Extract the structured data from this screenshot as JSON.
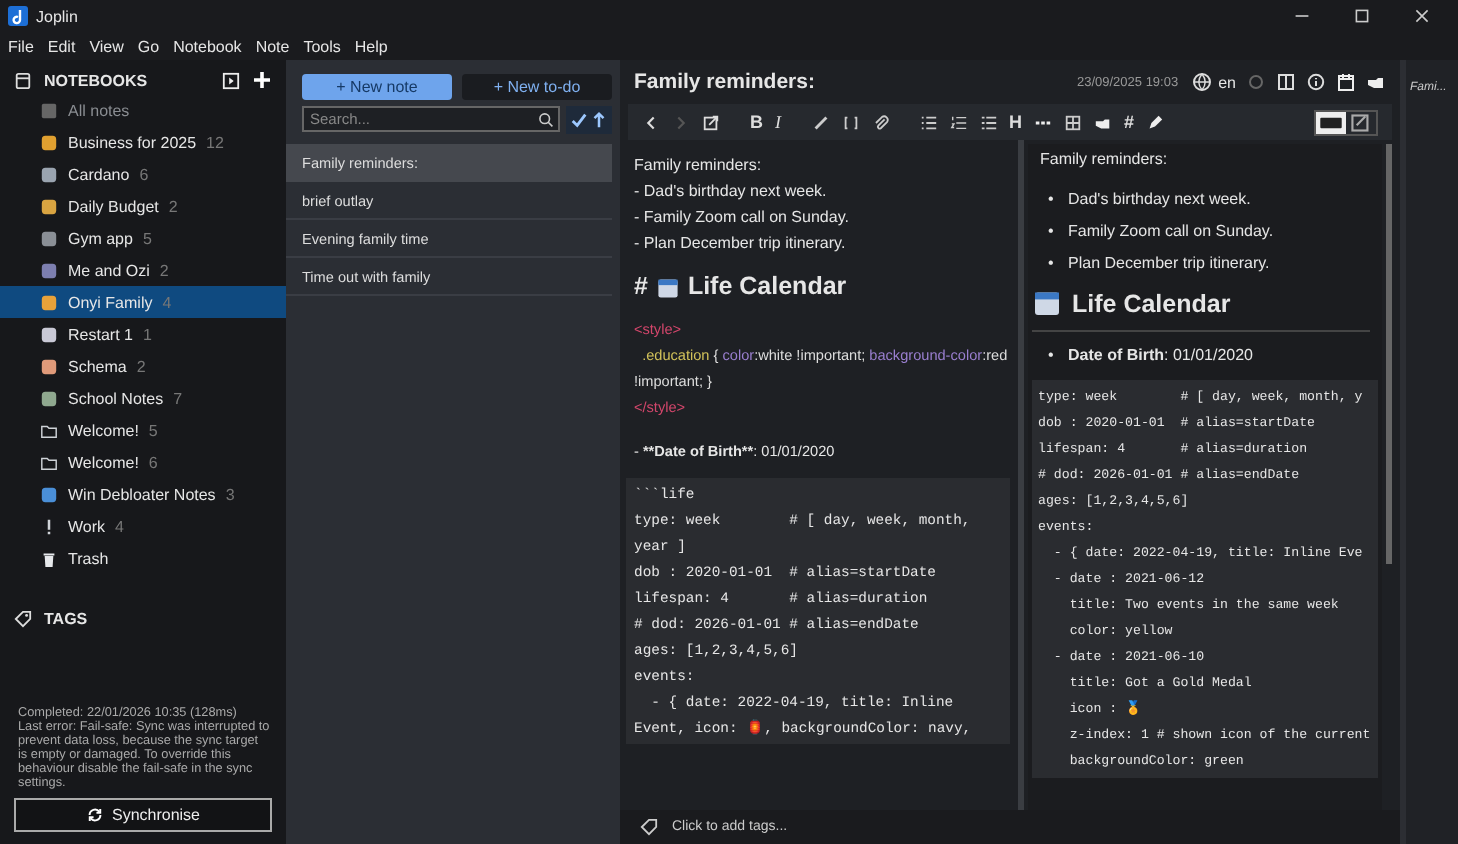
{
  "window": {
    "title": "Joplin"
  },
  "menu": [
    "File",
    "Edit",
    "View",
    "Go",
    "Notebook",
    "Note",
    "Tools",
    "Help"
  ],
  "sidebar": {
    "heading": "NOTEBOOKS",
    "all_notes": "All notes",
    "notebooks": [
      {
        "name": "Business for 2025",
        "count": "12",
        "kind": "emoji",
        "color": "#e0a030",
        "selected": false
      },
      {
        "name": "Cardano",
        "count": "6",
        "kind": "emoji",
        "color": "#9aa4b0",
        "selected": false
      },
      {
        "name": "Daily Budget",
        "count": "2",
        "kind": "emoji",
        "color": "#d9a441",
        "selected": false
      },
      {
        "name": "Gym app",
        "count": "5",
        "kind": "emoji",
        "color": "#8a8f96",
        "selected": false
      },
      {
        "name": "Me and Ozi",
        "count": "2",
        "kind": "emoji",
        "color": "#7d7fb0",
        "selected": false
      },
      {
        "name": "Onyi Family",
        "count": "4",
        "kind": "emoji",
        "color": "#e8a23a",
        "selected": true
      },
      {
        "name": "Restart 1",
        "count": "1",
        "kind": "emoji",
        "color": "#c9c9d6",
        "selected": false
      },
      {
        "name": "Schema",
        "count": "2",
        "kind": "emoji",
        "color": "#e09a7a",
        "selected": false
      },
      {
        "name": "School Notes",
        "count": "7",
        "kind": "emoji",
        "color": "#8fa88f",
        "selected": false
      },
      {
        "name": "Welcome!",
        "count": "5",
        "kind": "folder",
        "color": "#cfd3d8",
        "selected": false
      },
      {
        "name": "Welcome!",
        "count": "6",
        "kind": "folder",
        "color": "#cfd3d8",
        "selected": false
      },
      {
        "name": "Win Debloater Notes",
        "count": "3",
        "kind": "emoji",
        "color": "#4a8fd8",
        "selected": false
      },
      {
        "name": "Work",
        "count": "4",
        "kind": "bang",
        "color": "#cfd3d8",
        "selected": false
      },
      {
        "name": "Trash",
        "kind": "trash",
        "color": "#e6e8eb",
        "selected": false
      }
    ],
    "tags_heading": "TAGS",
    "sync_status": "Completed: 22/01/2026 10:35 (128ms)\nLast error: Fail-safe: Sync was interrupted to prevent data loss, because the sync target is empty or damaged. To override this behaviour disable the fail-safe in the sync settings.",
    "sync_button": "Synchronise"
  },
  "note_list": {
    "new_note": "New note",
    "new_todo": "New to-do",
    "plus": "+",
    "search": {
      "placeholder": "Search..."
    },
    "notes": [
      {
        "title": "Family reminders:",
        "selected": true
      },
      {
        "title": "brief outlay",
        "selected": false
      },
      {
        "title": "Evening family time",
        "selected": false
      },
      {
        "title": "Time out with family",
        "selected": false
      }
    ]
  },
  "editor": {
    "title": "Family reminders:",
    "date": "23/09/2025 19:03",
    "language": "en",
    "toolbar_glyphs": [
      "B",
      "I",
      "H",
      "#"
    ],
    "source": {
      "lines": [
        "Family reminders:",
        "- Dad's birthday next week.",
        "- Family Zoom call on Sunday.",
        "- Plan December trip itinerary."
      ],
      "heading_mark": "#",
      "heading": "Life Calendar",
      "style_open": "<style>",
      "css_selector": ".education",
      "css_brace": " { ",
      "css_body_1": "color",
      "css_body_2": ":white !important; ",
      "css_body_3": "background-color",
      "css_body_4": ":red !important; }",
      "style_close": "</style>",
      "dob_prefix": "- ",
      "dob_bold": "**Date of Birth**",
      "dob_value": ": 01/01/2020",
      "code": "```life\ntype: week        # [ day, week, month, year ]\ndob : 2020-01-01  # alias=startDate\nlifespan: 4       # alias=duration\n# dod: 2026-01-01 # alias=endDate\nages: [1,2,3,4,5,6]\nevents:\n  - { date: 2022-04-19, title: Inline Event, icon: 🏮, backgroundColor: navy,"
    },
    "preview": {
      "marker": "•",
      "intro": "Family reminders:",
      "bullets": [
        "Dad's birthday next week.",
        "Family Zoom call on Sunday.",
        "Plan December trip itinerary."
      ],
      "heading": "Life Calendar",
      "dob_label": "Date of Birth",
      "dob_value": ": 01/01/2020",
      "code": [
        "type: week        # [ day, week, month, y",
        "dob : 2020-01-01  # alias=startDate",
        "lifespan: 4       # alias=duration",
        "# dod: 2026-01-01 # alias=endDate",
        "ages: [1,2,3,4,5,6]",
        "events:",
        "  - { date: 2022-04-19, title: Inline Eve",
        "  - date : 2021-06-12",
        "    title: Two events in the same week",
        "    color: yellow",
        "  - date : 2021-06-10",
        "    title: Got a Gold Medal",
        "    icon : 🏅",
        "    z-index: 1 # shown icon of the current",
        "    backgroundColor: green"
      ]
    },
    "tags_placeholder": "Click to add tags..."
  },
  "next_pane": {
    "title": "Fami..."
  }
}
